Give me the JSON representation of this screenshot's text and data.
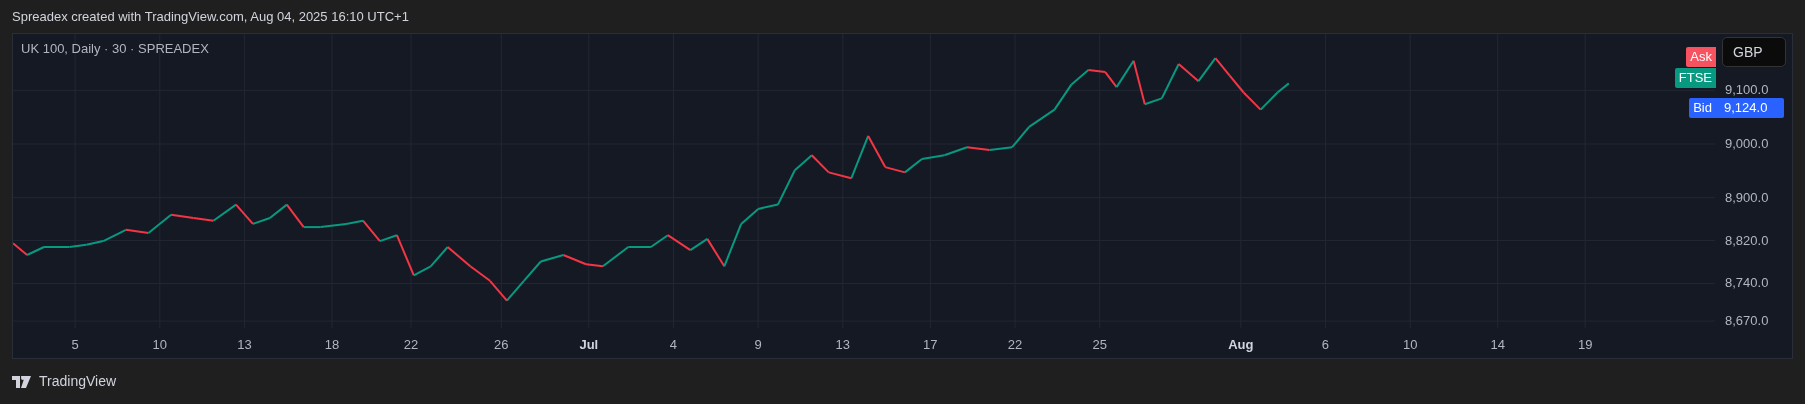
{
  "header": {
    "text": "Spreadex created with TradingView.com, Aug 04, 2025 16:10 UTC+1"
  },
  "chart": {
    "legend": "UK 100, Daily · 30 · SPREADEX",
    "currency_button": "GBP",
    "price_labels": [
      {
        "kind": "ask",
        "label": "Ask",
        "color": "#f7525f"
      },
      {
        "kind": "symbol",
        "label": "FTSE",
        "color": "#089981"
      },
      {
        "kind": "bid",
        "label": "Bid",
        "value": "9,124.0",
        "color": "#2962ff"
      }
    ],
    "price_axis_labels": [
      "9,100.0",
      "9,000.0",
      "8,900.0",
      "8,820.0",
      "8,740.0",
      "8,670.0"
    ],
    "time_axis_labels": [
      {
        "label": "5",
        "kind": "day"
      },
      {
        "label": "10",
        "kind": "day"
      },
      {
        "label": "13",
        "kind": "day"
      },
      {
        "label": "18",
        "kind": "day"
      },
      {
        "label": "22",
        "kind": "day"
      },
      {
        "label": "26",
        "kind": "day"
      },
      {
        "label": "Jul",
        "kind": "month"
      },
      {
        "label": "4",
        "kind": "day"
      },
      {
        "label": "9",
        "kind": "day"
      },
      {
        "label": "13",
        "kind": "day"
      },
      {
        "label": "17",
        "kind": "day"
      },
      {
        "label": "22",
        "kind": "day"
      },
      {
        "label": "25",
        "kind": "day"
      },
      {
        "label": "Aug",
        "kind": "month"
      },
      {
        "label": "6",
        "kind": "day"
      },
      {
        "label": "10",
        "kind": "day"
      },
      {
        "label": "14",
        "kind": "day"
      },
      {
        "label": "19",
        "kind": "day"
      }
    ]
  },
  "footer": {
    "logo_text": "TradingView"
  }
}
